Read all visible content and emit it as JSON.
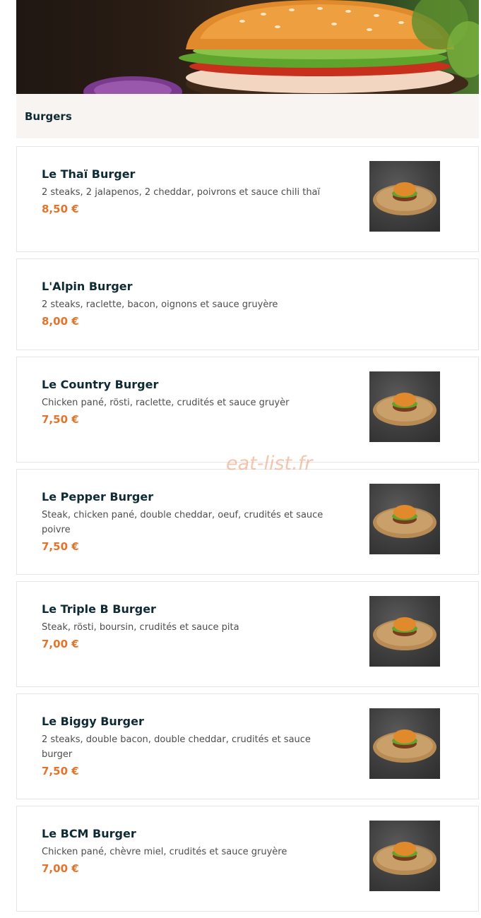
{
  "section": {
    "title": "Burgers"
  },
  "items": [
    {
      "name": "Le Thaï Burger",
      "desc": "2 steaks, 2 jalapenos, 2 cheddar, poivrons et sauce chili thaï",
      "price": "8,50 €",
      "has_image": true
    },
    {
      "name": "L'Alpin Burger",
      "desc": "2 steaks, raclette, bacon, oignons et sauce gruyère",
      "price": "8,00 €",
      "has_image": false
    },
    {
      "name": "Le Country Burger",
      "desc": "Chicken pané, rösti, raclette, crudités et sauce gruyèr",
      "price": "7,50 €",
      "has_image": true
    },
    {
      "name": "Le Pepper Burger",
      "desc": "Steak, chicken pané, double cheddar, oeuf, crudités et sauce poivre",
      "price": "7,50 €",
      "has_image": true
    },
    {
      "name": "Le Triple B Burger",
      "desc": "Steak, rösti, boursin, crudités et sauce pita",
      "price": "7,00 €",
      "has_image": true
    },
    {
      "name": "Le Biggy Burger",
      "desc": "2 steaks, double bacon, double cheddar, crudités et sauce burger",
      "price": "7,50 €",
      "has_image": true
    },
    {
      "name": "Le BCM Burger",
      "desc": "Chicken pané, chèvre miel, crudités et sauce gruyère",
      "price": "7,00 €",
      "has_image": true
    }
  ],
  "watermark": "eat-list.fr",
  "colors": {
    "title": "#0e2a33",
    "price": "#e3742b",
    "section_bg": "#f7f4f1"
  }
}
